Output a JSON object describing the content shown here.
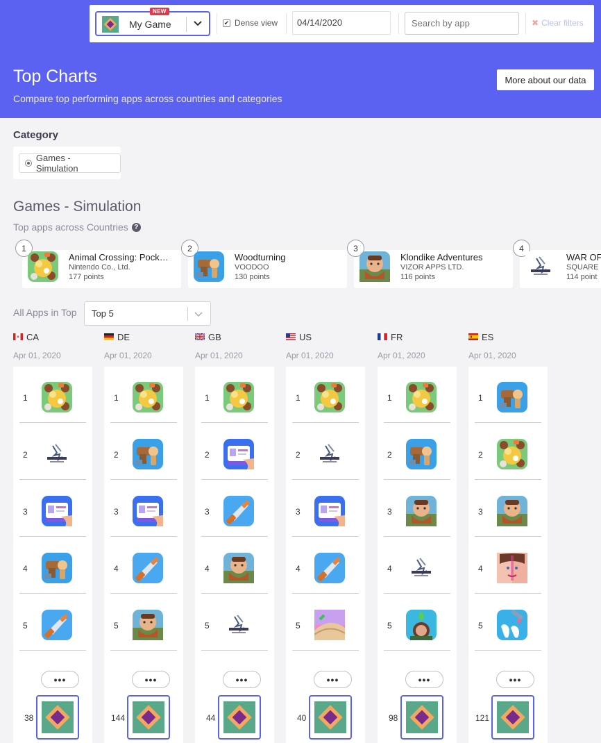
{
  "header": {
    "app_select": {
      "name": "My Game",
      "badge": "NEW",
      "icon": "my-game-icon"
    },
    "dense_view": {
      "label": "Dense view",
      "checked": true
    },
    "date": "04/14/2020",
    "search_placeholder": "Search by app",
    "clear_filters": "Clear filters",
    "title": "Top Charts",
    "subtitle": "Compare top performing apps across countries and categories",
    "more_button": "More about our data",
    "accent": "#5b61f0"
  },
  "category": {
    "heading": "Category",
    "selected": "Games - Simulation"
  },
  "section": {
    "title": "Games - Simulation",
    "subtitle": "Top apps across Countries",
    "help": "?"
  },
  "top_apps": [
    {
      "rank": "1",
      "name": "Animal Crossing: Pock…",
      "developer": "Nintendo Co., Ltd.",
      "points": "177 points",
      "icon": "animal-crossing"
    },
    {
      "rank": "2",
      "name": "Woodturning",
      "developer": "VOODOO",
      "points": "130 points",
      "icon": "woodturning"
    },
    {
      "rank": "3",
      "name": "Klondike Adventures",
      "developer": "VIZOR APPS LTD.",
      "points": "116 points",
      "icon": "klondike"
    },
    {
      "rank": "4",
      "name": "WAR OF",
      "developer": "SQUARE",
      "points": "114 point",
      "icon": "war-of-visions"
    }
  ],
  "filter": {
    "label": "All Apps in Top",
    "value": "Top 5"
  },
  "countries": [
    {
      "code": "CA",
      "flag": "flag-ca",
      "date": "Apr 01, 2020",
      "ranks": [
        "1",
        "2",
        "3",
        "4",
        "5"
      ],
      "apps": [
        "animal-crossing",
        "war-of-visions",
        "id-card",
        "woodturning",
        "knife"
      ],
      "more": "•••",
      "my_rank": "38"
    },
    {
      "code": "DE",
      "flag": "flag-de",
      "date": "Apr 01, 2020",
      "ranks": [
        "1",
        "2",
        "3",
        "4",
        "5"
      ],
      "apps": [
        "animal-crossing",
        "woodturning",
        "id-card",
        "knife",
        "klondike"
      ],
      "more": "•••",
      "my_rank": "144"
    },
    {
      "code": "GB",
      "flag": "flag-gb",
      "date": "Apr 01, 2020",
      "ranks": [
        "1",
        "2",
        "3",
        "4",
        "5"
      ],
      "apps": [
        "animal-crossing",
        "id-card",
        "knife",
        "klondike",
        "war-of-visions"
      ],
      "more": "•••",
      "my_rank": "44"
    },
    {
      "code": "US",
      "flag": "flag-us",
      "date": "Apr 01, 2020",
      "ranks": [
        "1",
        "2",
        "3",
        "4",
        "5"
      ],
      "apps": [
        "animal-crossing",
        "war-of-visions",
        "id-card",
        "knife",
        "sand-slide"
      ],
      "more": "•••",
      "my_rank": "40"
    },
    {
      "code": "FR",
      "flag": "flag-fr",
      "date": "Apr 01, 2020",
      "ranks": [
        "1",
        "2",
        "3",
        "4",
        "5"
      ],
      "apps": [
        "animal-crossing",
        "woodturning",
        "klondike",
        "war-of-visions",
        "sims-mobile"
      ],
      "more": "•••",
      "my_rank": "98"
    },
    {
      "code": "ES",
      "flag": "flag-es",
      "date": "Apr 01, 2020",
      "ranks": [
        "1",
        "2",
        "3",
        "4",
        "5"
      ],
      "apps": [
        "woodturning",
        "animal-crossing",
        "klondike",
        "makeover",
        "tooth-drill"
      ],
      "more": "•••",
      "my_rank": "121"
    }
  ]
}
